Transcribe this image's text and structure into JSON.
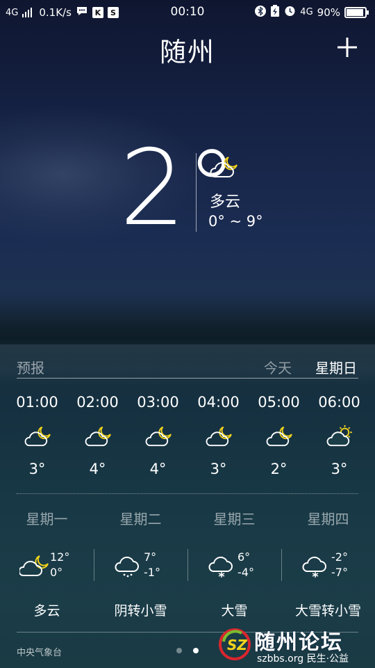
{
  "status_bar": {
    "network_left": "4G",
    "speed": "0.1K/s",
    "time": "00:10",
    "network_right": "4G",
    "battery": "90%",
    "icons": [
      "signal-icon",
      "chat-bubble-icon",
      "k-app-icon",
      "s-app-icon",
      "bluetooth-icon",
      "battery-charging-icon",
      "alarm-icon"
    ]
  },
  "header": {
    "city": "随州",
    "add_icon": "plus-icon"
  },
  "current": {
    "temp": "2°",
    "icon": "cloudy-night-icon",
    "condition": "多云",
    "range": "0° ~ 9°"
  },
  "forecast": {
    "title": "预报",
    "tabs": {
      "today": "今天",
      "sunday": "星期日"
    },
    "hourly": [
      {
        "time": "01:00",
        "icon": "cloudy-night-icon",
        "temp": "3°"
      },
      {
        "time": "02:00",
        "icon": "cloudy-night-icon",
        "temp": "4°"
      },
      {
        "time": "03:00",
        "icon": "cloudy-night-icon",
        "temp": "4°"
      },
      {
        "time": "04:00",
        "icon": "cloudy-night-icon",
        "temp": "3°"
      },
      {
        "time": "05:00",
        "icon": "cloudy-night-icon",
        "temp": "2°"
      },
      {
        "time": "06:00",
        "icon": "cloudy-day-icon",
        "temp": "3°"
      }
    ],
    "daily": [
      {
        "day": "星期一",
        "icon": "cloudy-night-icon",
        "high": "12°",
        "low": "0°",
        "condition": "多云"
      },
      {
        "day": "星期二",
        "icon": "light-snow-icon",
        "high": "7°",
        "low": "-1°",
        "condition": "阴转小雪"
      },
      {
        "day": "星期三",
        "icon": "heavy-snow-icon",
        "high": "6°",
        "low": "-4°",
        "condition": "大雪"
      },
      {
        "day": "星期四",
        "icon": "heavy-snow-icon",
        "high": "-2°",
        "low": "-7°",
        "condition": "大雪转小雪"
      }
    ]
  },
  "footer": {
    "source": "中央气象台",
    "pages": 2,
    "active_page": 2
  },
  "watermark": {
    "title": "随州论坛",
    "subtitle": "szbbs.org 民生·公益"
  },
  "colors": {
    "sun": "#f2d21b",
    "moon": "#f2d21b",
    "logo_red": "#d8262f",
    "logo_green": "#7dbb2e"
  }
}
